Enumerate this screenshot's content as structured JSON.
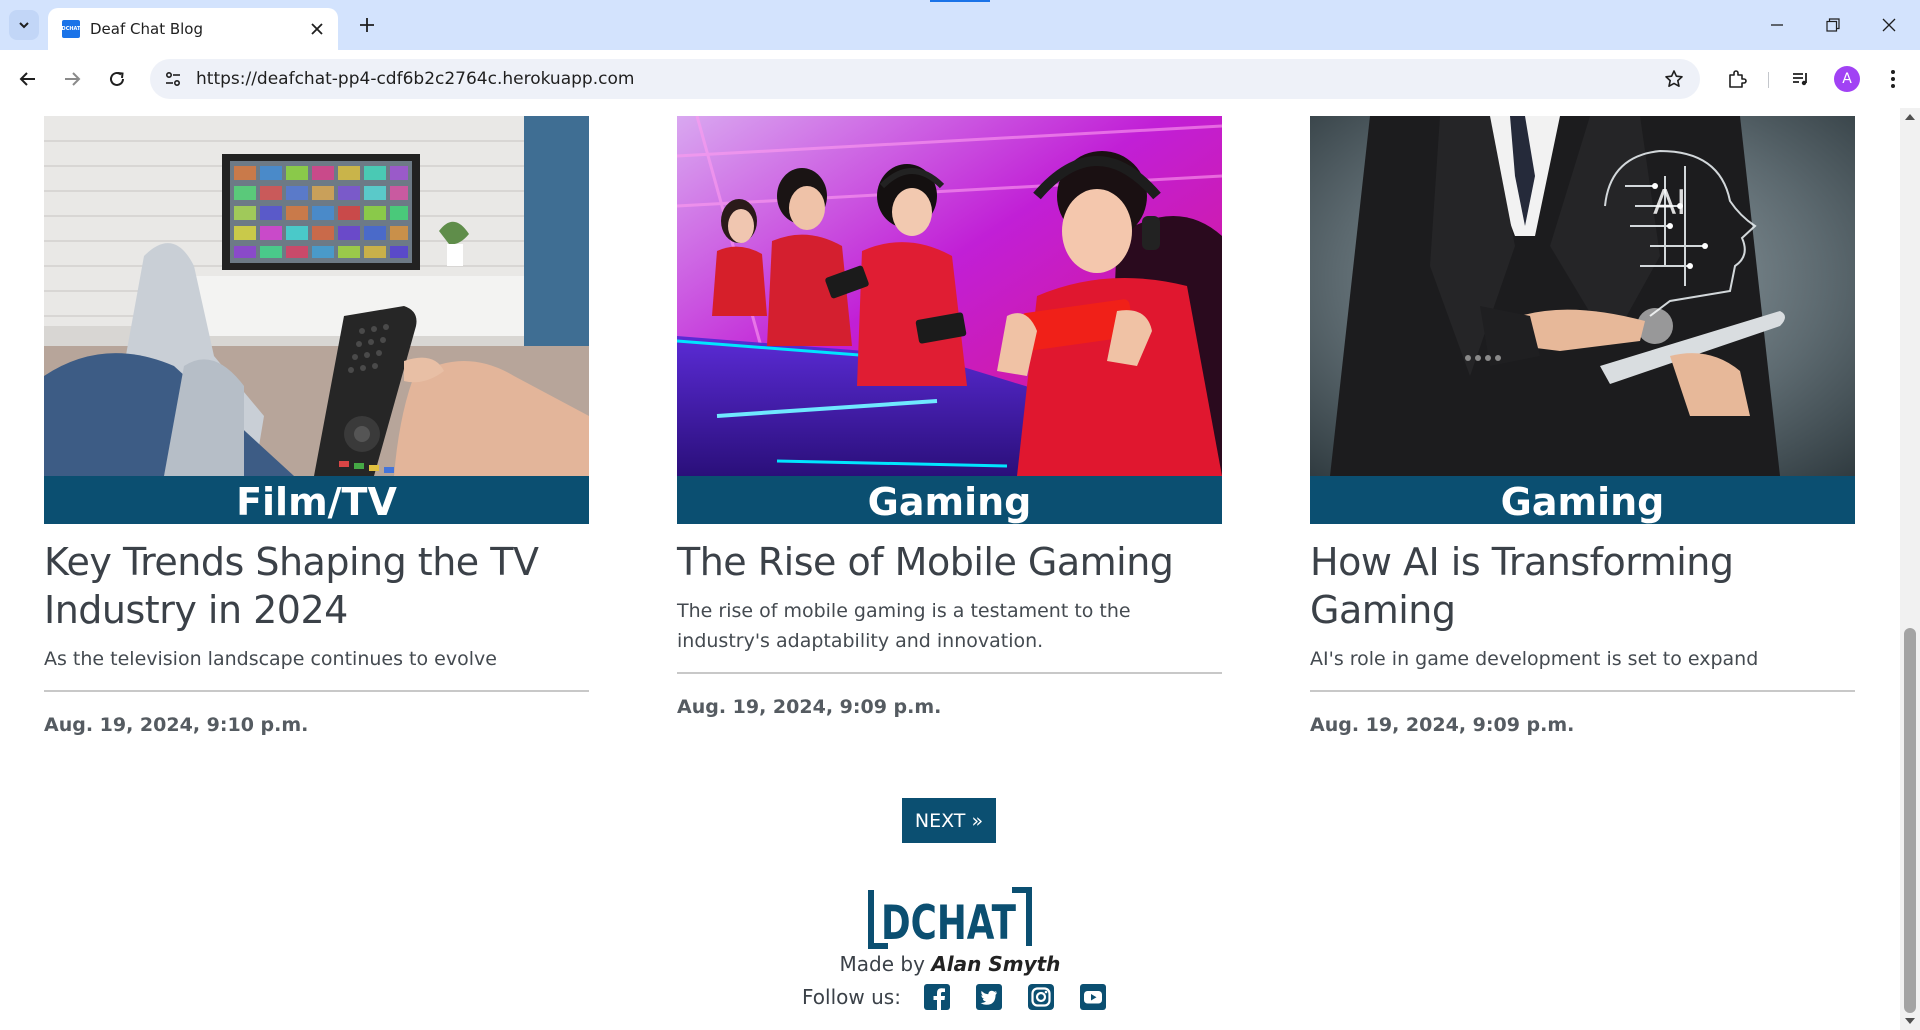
{
  "browser": {
    "tab_title": "Deaf Chat Blog",
    "favicon_text": "DCHAT",
    "url": "https://deafchat-pp4-cdf6b2c2764c.herokuapp.com",
    "profile_initial": "A"
  },
  "posts": [
    {
      "category": "Film/TV",
      "title": "Key Trends Shaping the TV Industry in 2024",
      "excerpt": "As the television landscape continues to evolve",
      "date": "Aug. 19, 2024, 9:10 p.m.",
      "image": "tv-remote-photo"
    },
    {
      "category": "Gaming",
      "title": "The Rise of Mobile Gaming",
      "excerpt": "The rise of mobile gaming is a testament to the industry's adaptability and innovation.",
      "date": "Aug. 19, 2024, 9:09 p.m.",
      "image": "mobile-gamers-photo"
    },
    {
      "category": "Gaming",
      "title": "How AI is Transforming Gaming",
      "excerpt": "AI's role in game development is set to expand",
      "date": "Aug. 19, 2024, 9:09 p.m.",
      "image": "ai-businessman-photo"
    }
  ],
  "pagination": {
    "next_label": "NEXT »"
  },
  "footer": {
    "logo_text": "DCHAT",
    "made_by_prefix": "Made by",
    "author": "Alan Smyth",
    "follow_label": "Follow us:",
    "social": [
      "facebook-icon",
      "twitter-icon",
      "instagram-icon",
      "youtube-icon"
    ]
  },
  "colors": {
    "brand": "#0b4f71",
    "tabbar": "#d3e3fd",
    "text": "#3b4148"
  }
}
